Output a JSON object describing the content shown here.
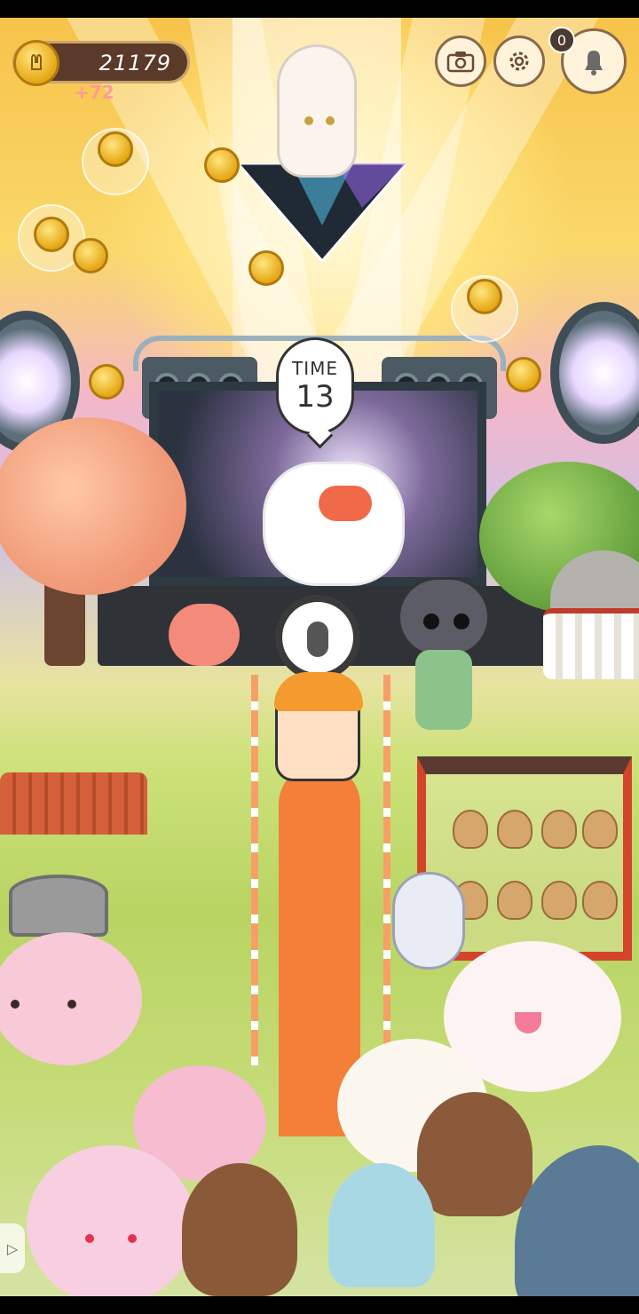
{
  "hud": {
    "coins": "21179",
    "coin_gain": "+72",
    "notification_count": "0"
  },
  "timer": {
    "label": "TIME",
    "value": "13"
  },
  "colors": {
    "runway": "#f37f38",
    "coin": "#e6a714",
    "hud_frame": "#8a6a4a"
  },
  "icons": [
    "coin-icon",
    "camera-icon",
    "gear-icon",
    "bell-icon",
    "play-icon"
  ]
}
